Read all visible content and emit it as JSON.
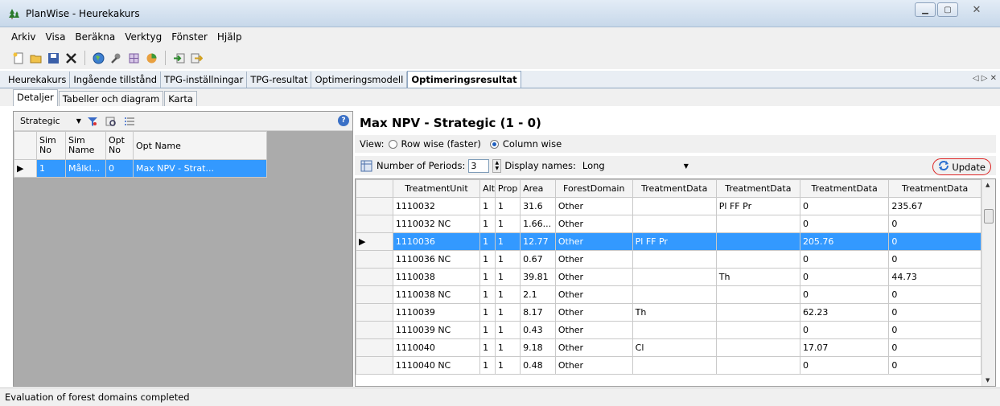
{
  "window": {
    "title": "PlanWise - Heurekakurs"
  },
  "menu": [
    "Arkiv",
    "Visa",
    "Beräkna",
    "Verktyg",
    "Fönster",
    "Hjälp"
  ],
  "doc_tabs": [
    "Heurekakurs",
    "Ingående tillstånd",
    "TPG-inställningar",
    "TPG-resultat",
    "Optimeringsmodell",
    "Optimeringsresultat"
  ],
  "sub_tabs": [
    "Detaljer",
    "Tabeller och diagram",
    "Karta"
  ],
  "left": {
    "dropdown": "Strategic",
    "columns": [
      "Sim No",
      "Sim Name",
      "Opt No",
      "Opt Name"
    ],
    "rows": [
      {
        "sim_no": "1",
        "sim_name": "Målkl...",
        "opt_no": "0",
        "opt_name": "Max NPV - Strat..."
      }
    ]
  },
  "right": {
    "title": "Max NPV - Strategic (1 - 0)",
    "view_label": "View:",
    "view_rowwise": "Row wise (faster)",
    "view_colwise": "Column wise",
    "periods_label": "Number of Periods:",
    "periods_value": "3",
    "display_label": "Display names:",
    "display_value": "Long",
    "update": "Update",
    "columns": [
      "TreatmentUnit",
      "Alt",
      "Prop",
      "Area",
      "ForestDomain",
      "TreatmentData",
      "TreatmentData",
      "TreatmentData",
      "TreatmentData"
    ],
    "rows": [
      [
        "1110032",
        "1",
        "1",
        "31.6",
        "Other",
        "",
        "Pl FF Pr",
        "0",
        "235.67"
      ],
      [
        "1110032  NC",
        "1",
        "1",
        "1.66...",
        "Other",
        "",
        "",
        "0",
        "0"
      ],
      [
        "1110036",
        "1",
        "1",
        "12.77",
        "Other",
        "Pl FF Pr",
        "",
        "205.76",
        "0"
      ],
      [
        "1110036  NC",
        "1",
        "1",
        "0.67",
        "Other",
        "",
        "",
        "0",
        "0"
      ],
      [
        "1110038",
        "1",
        "1",
        "39.81",
        "Other",
        "",
        "Th",
        "0",
        "44.73"
      ],
      [
        "1110038  NC",
        "1",
        "1",
        "2.1",
        "Other",
        "",
        "",
        "0",
        "0"
      ],
      [
        "1110039",
        "1",
        "1",
        "8.17",
        "Other",
        "Th",
        "",
        "62.23",
        "0"
      ],
      [
        "1110039  NC",
        "1",
        "1",
        "0.43",
        "Other",
        "",
        "",
        "0",
        "0"
      ],
      [
        "1110040",
        "1",
        "1",
        "9.18",
        "Other",
        "Cl",
        "",
        "17.07",
        "0"
      ],
      [
        "1110040  NC",
        "1",
        "1",
        "0.48",
        "Other",
        "",
        "",
        "0",
        "0"
      ]
    ]
  },
  "status": "Evaluation of forest domains completed"
}
